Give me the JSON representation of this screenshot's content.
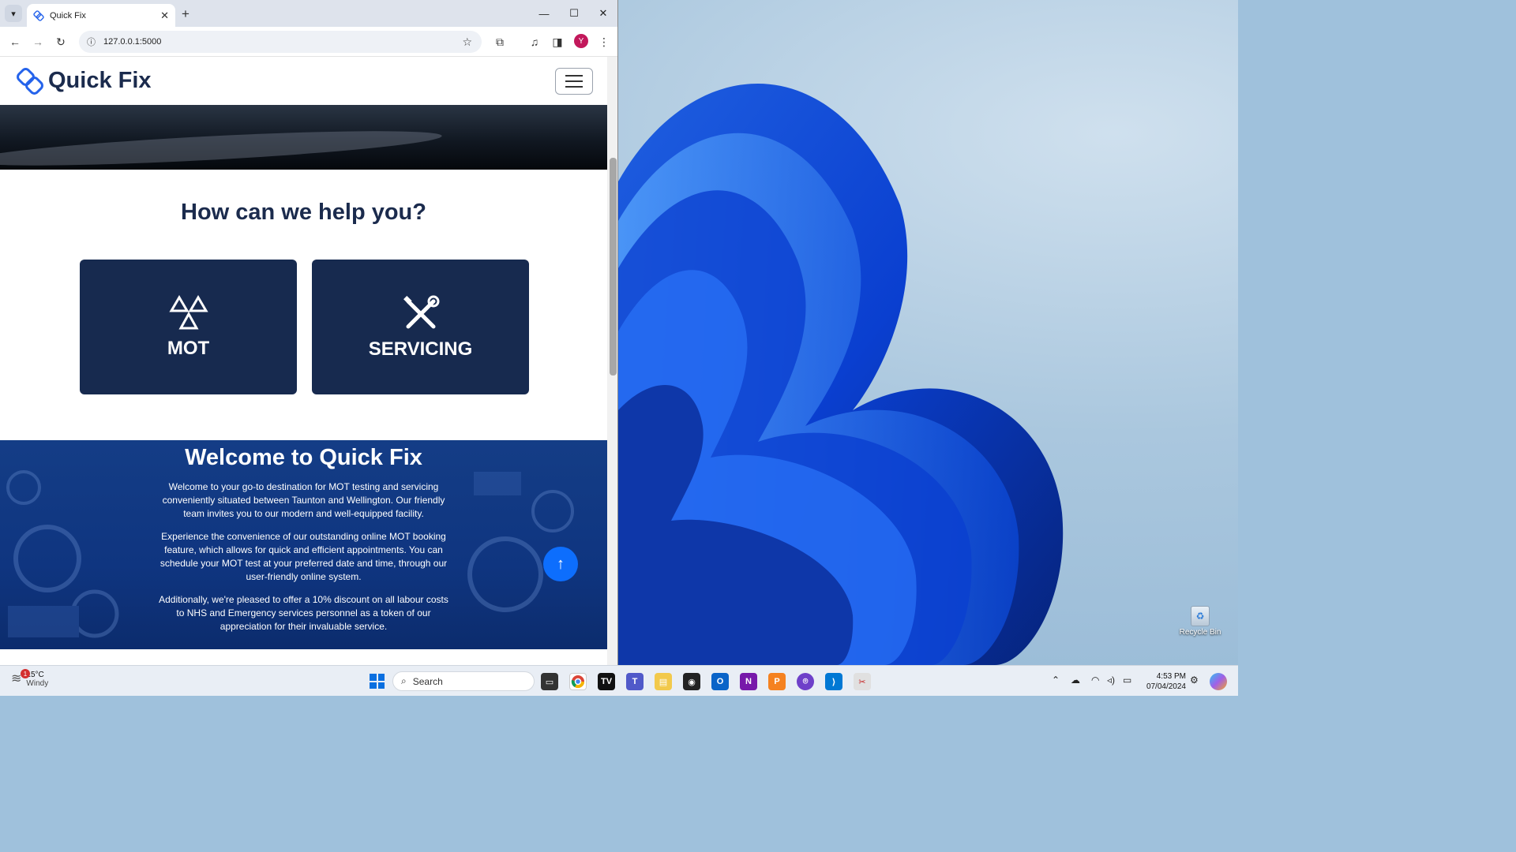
{
  "browser": {
    "tab_title": "Quick Fix",
    "url": "127.0.0.1:5000",
    "profile_initial": "Y"
  },
  "site": {
    "brand": "Quick Fix",
    "help_heading": "How can we help you?",
    "cards": [
      {
        "label": "MOT",
        "icon": "mot-triangles-icon"
      },
      {
        "label": "SERVICING",
        "icon": "wrench-screwdriver-icon"
      }
    ],
    "welcome": {
      "heading": "Welcome to Quick Fix",
      "paragraphs": [
        "Welcome to your go-to destination for MOT testing and servicing conveniently situated between Taunton and Wellington. Our friendly team invites you to our modern and well-equipped facility.",
        "Experience the convenience of our outstanding online MOT booking feature, which allows for quick and efficient appointments. You can schedule your MOT test at your preferred date and time, through our user-friendly online system.",
        "Additionally, we're pleased to offer a 10% discount on all labour costs to NHS and Emergency services personnel as a token of our appreciation for their invaluable service."
      ]
    }
  },
  "desktop": {
    "recycle_bin_label": "Recycle Bin"
  },
  "taskbar": {
    "weather_temp": "15°C",
    "weather_condition": "Windy",
    "weather_badge": "1",
    "search_placeholder": "Search",
    "time": "4:53 PM",
    "date": "07/04/2024"
  },
  "colors": {
    "brand_navy": "#1b2b4d",
    "card_bg": "#172a4f",
    "welcome_bg": "#143d86",
    "accent_blue": "#0d6efd"
  }
}
